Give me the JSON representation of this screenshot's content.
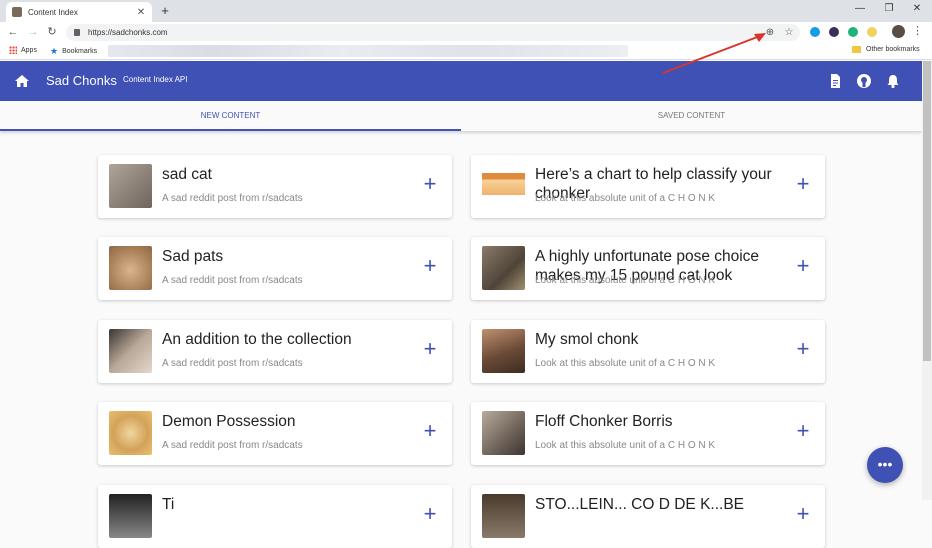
{
  "browser": {
    "tab_title": "Content Index",
    "url": "https://sadchonks.com",
    "bookmarks": {
      "apps": "Apps",
      "bookmarks": "Bookmarks",
      "other": "Other bookmarks"
    }
  },
  "appbar": {
    "brand": "Sad Chonks",
    "subtitle": "Content Index API"
  },
  "tabs": [
    {
      "label": "NEW CONTENT",
      "active": true
    },
    {
      "label": "SAVED CONTENT",
      "active": false
    }
  ],
  "cards": [
    {
      "title": "sad cat",
      "description": "A sad reddit post from r/sadcats",
      "thumb": "#8a7f78"
    },
    {
      "title": "Here’s a chart to help classify your chonker",
      "description": "Look at this absolute unit of a C H O N K",
      "thumb": "#d9a46b"
    },
    {
      "title": "Sad pats",
      "description": "A sad reddit post from r/sadcats",
      "thumb": "#c8a27c"
    },
    {
      "title": "A highly unfortunate pose choice makes my 15 pound cat look",
      "description": "Look at this absolute unit of a C H O N K",
      "thumb": "#6f6456"
    },
    {
      "title": "An addition to the collection",
      "description": "A sad reddit post from r/sadcats",
      "thumb": "#9c8a7b"
    },
    {
      "title": "My smol chonk",
      "description": "Look at this absolute unit of a C H O N K",
      "thumb": "#7c5a44"
    },
    {
      "title": "Demon Possession",
      "description": "A sad reddit post from r/sadcats",
      "thumb": "#d4a25a"
    },
    {
      "title": "Floff Chonker Borris",
      "description": "Look at this absolute unit of a C H O N K",
      "thumb": "#857a70"
    },
    {
      "title": "Ti",
      "description": "",
      "thumb": "#4a4a4a"
    },
    {
      "title": "STO...LEIN... CO D DE K...BE",
      "description": "",
      "thumb": "#6b5b4b"
    }
  ],
  "colors": {
    "primary": "#3f51b5",
    "annotation": "#d9342b"
  }
}
